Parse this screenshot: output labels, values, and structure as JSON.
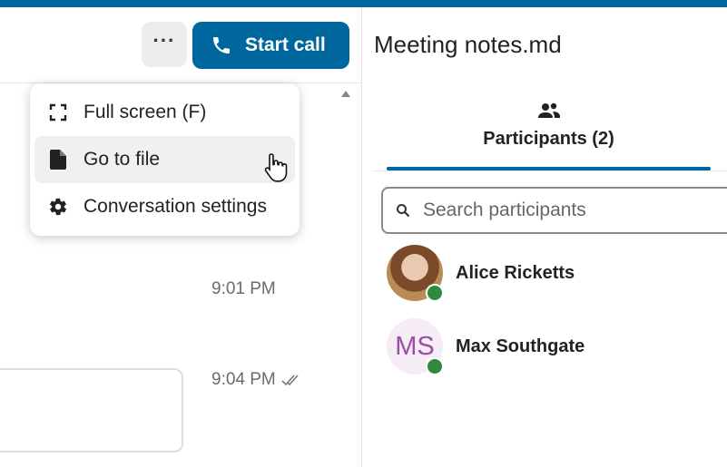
{
  "colors": {
    "accent": "#00679e",
    "online": "#2e8b3e",
    "avatar_initials_bg": "#f5ecf5",
    "avatar_initials_fg": "#9b4ea4"
  },
  "header": {
    "more_label": "···",
    "start_call_label": "Start call"
  },
  "menu": {
    "items": [
      {
        "label": "Full screen (F)",
        "icon": "fullscreen-icon"
      },
      {
        "label": "Go to file",
        "icon": "file-icon"
      },
      {
        "label": "Conversation settings",
        "icon": "gear-icon"
      }
    ]
  },
  "messages": [
    {
      "time": "9:01 PM"
    },
    {
      "time": "9:04 PM",
      "status": "read-checkmarks"
    }
  ],
  "sidebar": {
    "file_title": "Meeting notes.md",
    "tab_label": "Participants (2)",
    "search_placeholder": "Search participants",
    "participants": [
      {
        "name": "Alice Ricketts",
        "avatar": "photo",
        "status": "online"
      },
      {
        "name": "Max Southgate",
        "initials": "MS",
        "status": "online"
      }
    ]
  }
}
